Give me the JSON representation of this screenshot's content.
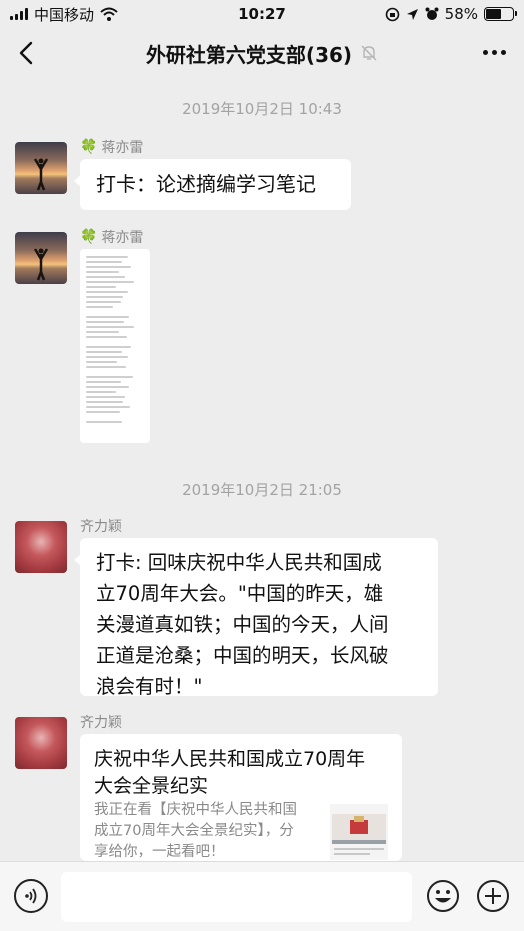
{
  "status_bar": {
    "carrier": "中国移动",
    "time": "10:27",
    "battery_percent": "58%",
    "battery_level": 0.58,
    "icons": [
      "signal-icon",
      "wifi-icon",
      "rotation-lock-icon",
      "location-icon",
      "alarm-icon",
      "battery-icon"
    ]
  },
  "nav": {
    "title": "外研社第六党支部(36)",
    "icons": [
      "back-icon",
      "mute-bell-icon",
      "more-icon"
    ]
  },
  "timestamps": [
    "2019年10月2日 10:43",
    "2019年10月2日 21:05"
  ],
  "messages": [
    {
      "sender": "蒋亦雷",
      "sender_icon": "clover-icon",
      "text": "打卡：论述摘编学习笔记"
    },
    {
      "sender": "蒋亦雷",
      "sender_icon": "clover-icon",
      "type": "image"
    },
    {
      "sender": "齐力颖",
      "text_lines": [
        "打卡: 回味庆祝中华人民共和国成",
        "立70周年大会。\"中国的昨天，雄",
        "关漫道真如铁；中国的今天，人间",
        "正道是沧桑；中国的明天，长风破",
        "浪会有时！\""
      ]
    },
    {
      "sender": "齐力颖",
      "type": "link_card",
      "card_title_lines": [
        "庆祝中华人民共和国成立70周年",
        "大会全景纪实"
      ],
      "card_desc_lines": [
        "我正在看【庆祝中华人民共和国",
        "成立70周年大会全景纪实】，分",
        "享给你，一起看吧！"
      ]
    }
  ],
  "input_bar": {
    "placeholder": "",
    "icons": [
      "voice-icon",
      "emoji-icon",
      "plus-icon"
    ]
  },
  "colors": {
    "background": "#ededed",
    "bubble": "#ffffff",
    "meta_text": "#a3a3a3"
  }
}
